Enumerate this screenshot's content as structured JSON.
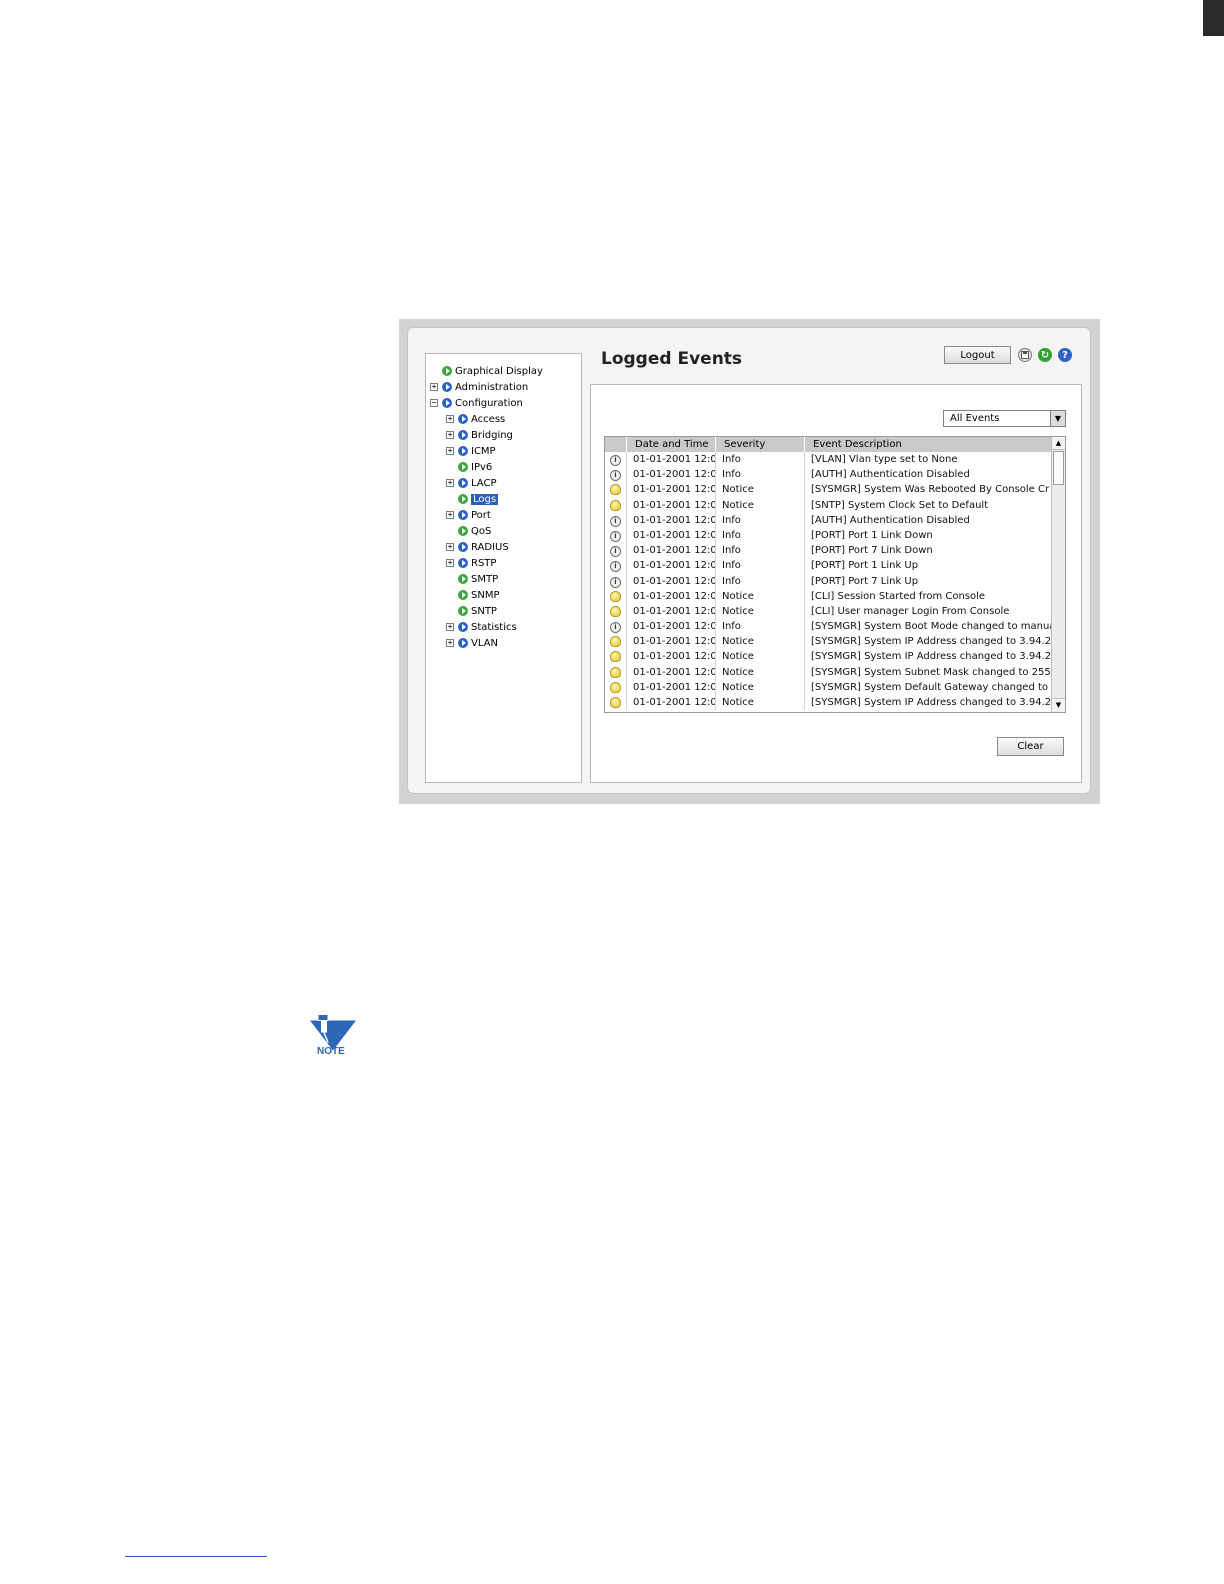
{
  "nav": {
    "items": [
      {
        "label": "Graphical Display",
        "bullet": "green",
        "toggle": ""
      },
      {
        "label": "Administration",
        "bullet": "blue",
        "toggle": "+"
      },
      {
        "label": "Configuration",
        "bullet": "blue",
        "toggle": "−"
      },
      {
        "label": "Access",
        "bullet": "blue",
        "toggle": "+"
      },
      {
        "label": "Bridging",
        "bullet": "blue",
        "toggle": "+"
      },
      {
        "label": "ICMP",
        "bullet": "blue",
        "toggle": "+"
      },
      {
        "label": "IPv6",
        "bullet": "green",
        "toggle": ""
      },
      {
        "label": "LACP",
        "bullet": "blue",
        "toggle": "+"
      },
      {
        "label": "Logs",
        "bullet": "green",
        "toggle": "",
        "selected": true
      },
      {
        "label": "Port",
        "bullet": "blue",
        "toggle": "+"
      },
      {
        "label": "QoS",
        "bullet": "green",
        "toggle": ""
      },
      {
        "label": "RADIUS",
        "bullet": "blue",
        "toggle": "+"
      },
      {
        "label": "RSTP",
        "bullet": "blue",
        "toggle": "+"
      },
      {
        "label": "SMTP",
        "bullet": "green",
        "toggle": ""
      },
      {
        "label": "SNMP",
        "bullet": "green",
        "toggle": ""
      },
      {
        "label": "SNTP",
        "bullet": "green",
        "toggle": ""
      },
      {
        "label": "Statistics",
        "bullet": "blue",
        "toggle": "+"
      },
      {
        "label": "VLAN",
        "bullet": "blue",
        "toggle": "+"
      }
    ]
  },
  "header": {
    "title": "Logged Events",
    "logout_label": "Logout",
    "icons": [
      "save-icon",
      "refresh-icon",
      "help-icon"
    ]
  },
  "filter": {
    "selected": "All Events"
  },
  "table": {
    "columns": [
      "",
      "Date and Time",
      "Severity",
      "Event Description"
    ],
    "rows": [
      {
        "icon": "info",
        "date": "01-01-2001 12:0",
        "severity": "Info",
        "desc": "[VLAN] Vlan type set to None"
      },
      {
        "icon": "info",
        "date": "01-01-2001 12:0",
        "severity": "Info",
        "desc": "[AUTH] Authentication Disabled"
      },
      {
        "icon": "notice",
        "date": "01-01-2001 12:0",
        "severity": "Notice",
        "desc": "[SYSMGR] System Was Rebooted By Console Cr"
      },
      {
        "icon": "notice",
        "date": "01-01-2001 12:0",
        "severity": "Notice",
        "desc": "[SNTP] System Clock Set to Default"
      },
      {
        "icon": "info",
        "date": "01-01-2001 12:0",
        "severity": "Info",
        "desc": "[AUTH] Authentication Disabled"
      },
      {
        "icon": "info",
        "date": "01-01-2001 12:0",
        "severity": "Info",
        "desc": "[PORT] Port 1 Link Down"
      },
      {
        "icon": "info",
        "date": "01-01-2001 12:0",
        "severity": "Info",
        "desc": "[PORT] Port 7 Link Down"
      },
      {
        "icon": "info",
        "date": "01-01-2001 12:0",
        "severity": "Info",
        "desc": "[PORT] Port 1 Link Up"
      },
      {
        "icon": "info",
        "date": "01-01-2001 12:0",
        "severity": "Info",
        "desc": "[PORT] Port 7 Link Up"
      },
      {
        "icon": "notice",
        "date": "01-01-2001 12:0",
        "severity": "Notice",
        "desc": "[CLI] Session Started from Console"
      },
      {
        "icon": "notice",
        "date": "01-01-2001 12:0",
        "severity": "Notice",
        "desc": "[CLI] User manager Login From Console"
      },
      {
        "icon": "info",
        "date": "01-01-2001 12:0",
        "severity": "Info",
        "desc": "[SYSMGR] System Boot Mode changed to manua"
      },
      {
        "icon": "notice",
        "date": "01-01-2001 12:0",
        "severity": "Notice",
        "desc": "[SYSMGR] System IP Address changed to 3.94.2"
      },
      {
        "icon": "notice",
        "date": "01-01-2001 12:0",
        "severity": "Notice",
        "desc": "[SYSMGR] System IP Address changed to 3.94.2"
      },
      {
        "icon": "notice",
        "date": "01-01-2001 12:0",
        "severity": "Notice",
        "desc": "[SYSMGR] System Subnet Mask changed to 255."
      },
      {
        "icon": "notice",
        "date": "01-01-2001 12:0",
        "severity": "Notice",
        "desc": "[SYSMGR] System Default Gateway changed to 3"
      },
      {
        "icon": "notice",
        "date": "01-01-2001 12:0",
        "severity": "Notice",
        "desc": "[SYSMGR] System IP Address changed to 3.94.2"
      }
    ]
  },
  "actions": {
    "clear_label": "Clear"
  },
  "note": {
    "label": "NOTE"
  }
}
